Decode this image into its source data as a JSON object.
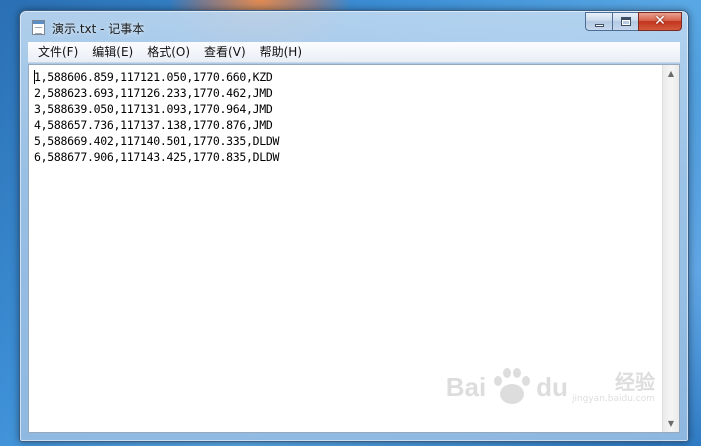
{
  "window": {
    "title": "演示.txt - 记事本",
    "minimize_label": "",
    "maximize_label": "",
    "close_label": "✕"
  },
  "menu": {
    "items": [
      {
        "label": "文件(F)"
      },
      {
        "label": "编辑(E)"
      },
      {
        "label": "格式(O)"
      },
      {
        "label": "查看(V)"
      },
      {
        "label": "帮助(H)"
      }
    ]
  },
  "editor": {
    "lines": [
      "1,588606.859,117121.050,1770.660,KZD",
      "2,588623.693,117126.233,1770.462,JMD",
      "3,588639.050,117131.093,1770.964,JMD",
      "4,588657.736,117137.138,1770.876,JMD",
      "5,588669.402,117140.501,1770.335,DLDW",
      "6,588677.906,117143.425,1770.835,DLDW"
    ]
  },
  "scrollbar": {
    "up_glyph": "▲",
    "down_glyph": "▼"
  },
  "watermark": {
    "brand_left": "Bai",
    "brand_right": "du",
    "brand_cn": "经验",
    "url": "jingyan.baidu.com"
  },
  "icons": {
    "app": "notepad-icon",
    "minimize": "minimize-icon",
    "maximize": "maximize-icon",
    "close": "close-icon",
    "watermark": "baidu-paw-icon"
  }
}
